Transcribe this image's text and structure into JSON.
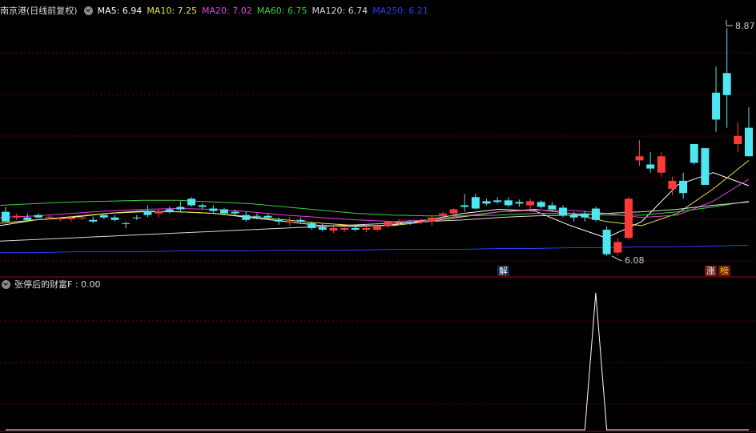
{
  "header": {
    "stock_title": "南京港(日线前复权)",
    "ma": [
      {
        "label": "MA5: 6.94",
        "color": "#ffffff"
      },
      {
        "label": "MA10: 7.25",
        "color": "#e6e64a"
      },
      {
        "label": "MA20: 7.02",
        "color": "#e040e0"
      },
      {
        "label": "MA60: 6.75",
        "color": "#3fcf3f"
      },
      {
        "label": "MA120: 6.74",
        "color": "#d8d8d8"
      },
      {
        "label": "MA250: 6.21",
        "color": "#2a3cff"
      }
    ]
  },
  "price_labels": {
    "high": "8.87",
    "low": "6.08"
  },
  "markers": {
    "jie": "解",
    "zhang": "涨",
    "bang": "榜"
  },
  "indicator": {
    "label": "张停后的财富F : 0.00"
  },
  "colors": {
    "up": "#ff3a3a",
    "down": "#4ee6f0",
    "grid": "#7a0000",
    "frame": "#b00000"
  },
  "chart_data": {
    "type": "candlestick",
    "price_range": [
      5.9,
      9.0
    ],
    "candles": [
      [
        6.62,
        6.68,
        6.55,
        6.5
      ],
      [
        6.55,
        6.6,
        6.52,
        6.57
      ],
      [
        6.55,
        6.6,
        6.5,
        6.52
      ],
      [
        6.58,
        6.6,
        6.54,
        6.55
      ],
      [
        6.55,
        6.58,
        6.52,
        6.56
      ],
      [
        6.53,
        6.55,
        6.5,
        6.54
      ],
      [
        6.53,
        6.56,
        6.5,
        6.55
      ],
      [
        6.54,
        6.58,
        6.52,
        6.55
      ],
      [
        6.52,
        6.56,
        6.48,
        6.5
      ],
      [
        6.58,
        6.6,
        6.53,
        6.55
      ],
      [
        6.55,
        6.58,
        6.5,
        6.52
      ],
      [
        6.48,
        6.5,
        6.42,
        6.47
      ],
      [
        6.55,
        6.58,
        6.52,
        6.54
      ],
      [
        6.63,
        6.7,
        6.55,
        6.58
      ],
      [
        6.6,
        6.65,
        6.55,
        6.63
      ],
      [
        6.65,
        6.68,
        6.6,
        6.62
      ],
      [
        6.68,
        6.75,
        6.62,
        6.65
      ],
      [
        6.78,
        6.8,
        6.68,
        6.7
      ],
      [
        6.7,
        6.72,
        6.65,
        6.68
      ],
      [
        6.66,
        6.7,
        6.6,
        6.63
      ],
      [
        6.65,
        6.67,
        6.58,
        6.6
      ],
      [
        6.62,
        6.65,
        6.57,
        6.6
      ],
      [
        6.58,
        6.63,
        6.5,
        6.52
      ],
      [
        6.57,
        6.6,
        6.53,
        6.56
      ],
      [
        6.57,
        6.6,
        6.52,
        6.55
      ],
      [
        6.52,
        6.55,
        6.46,
        6.5
      ],
      [
        6.5,
        6.56,
        6.45,
        6.5
      ],
      [
        6.52,
        6.55,
        6.48,
        6.5
      ],
      [
        6.48,
        6.5,
        6.4,
        6.42
      ],
      [
        6.43,
        6.47,
        6.38,
        6.4
      ],
      [
        6.39,
        6.44,
        6.36,
        6.42
      ],
      [
        6.4,
        6.45,
        6.37,
        6.42
      ],
      [
        6.42,
        6.45,
        6.38,
        6.4
      ],
      [
        6.4,
        6.44,
        6.37,
        6.42
      ],
      [
        6.4,
        6.45,
        6.38,
        6.44
      ],
      [
        6.45,
        6.5,
        6.42,
        6.5
      ],
      [
        6.5,
        6.53,
        6.45,
        6.5
      ],
      [
        6.5,
        6.52,
        6.46,
        6.49
      ],
      [
        6.5,
        6.53,
        6.47,
        6.5
      ],
      [
        6.5,
        6.58,
        6.45,
        6.55
      ],
      [
        6.58,
        6.62,
        6.55,
        6.6
      ],
      [
        6.6,
        6.66,
        6.55,
        6.65
      ],
      [
        6.7,
        6.84,
        6.62,
        6.68
      ],
      [
        6.8,
        6.84,
        6.65,
        6.66
      ],
      [
        6.75,
        6.78,
        6.7,
        6.72
      ],
      [
        6.76,
        6.8,
        6.72,
        6.74
      ],
      [
        6.76,
        6.8,
        6.68,
        6.7
      ],
      [
        6.74,
        6.77,
        6.68,
        6.72
      ],
      [
        6.7,
        6.78,
        6.65,
        6.75
      ],
      [
        6.74,
        6.76,
        6.66,
        6.68
      ],
      [
        6.7,
        6.74,
        6.62,
        6.65
      ],
      [
        6.67,
        6.7,
        6.55,
        6.58
      ],
      [
        6.58,
        6.62,
        6.5,
        6.55
      ],
      [
        6.6,
        6.63,
        6.5,
        6.55
      ],
      [
        6.66,
        6.68,
        6.5,
        6.52
      ],
      [
        6.4,
        6.44,
        6.08,
        6.1
      ],
      [
        6.12,
        6.3,
        6.08,
        6.25
      ],
      [
        6.3,
        6.8,
        6.28,
        6.78
      ],
      [
        7.25,
        7.5,
        7.18,
        7.3
      ],
      [
        7.2,
        7.35,
        7.1,
        7.15
      ],
      [
        7.1,
        7.35,
        7.05,
        7.3
      ],
      [
        6.9,
        7.05,
        6.82,
        7.0
      ],
      [
        7.0,
        7.1,
        6.78,
        6.85
      ],
      [
        7.45,
        7.45,
        7.2,
        7.22
      ],
      [
        7.4,
        7.4,
        6.95,
        6.95
      ],
      [
        8.08,
        8.4,
        7.6,
        7.75
      ],
      [
        8.32,
        8.87,
        7.65,
        8.05
      ],
      [
        7.45,
        7.72,
        7.35,
        7.55
      ],
      [
        7.65,
        7.9,
        7.3,
        7.3
      ]
    ],
    "ma": {
      "MA5": [
        6.45,
        6.52,
        6.55,
        6.6,
        6.63,
        6.62,
        6.6,
        6.55,
        6.5,
        6.45,
        6.44,
        6.46,
        6.52,
        6.6,
        6.65,
        6.63,
        6.45,
        6.3,
        6.5,
        6.95,
        7.1,
        6.94
      ],
      "MA10": [
        6.48,
        6.52,
        6.56,
        6.6,
        6.62,
        6.62,
        6.6,
        6.56,
        6.52,
        6.48,
        6.45,
        6.45,
        6.5,
        6.56,
        6.62,
        6.65,
        6.6,
        6.5,
        6.45,
        6.6,
        6.9,
        7.25
      ],
      "MA20": [
        6.55,
        6.57,
        6.6,
        6.63,
        6.65,
        6.66,
        6.65,
        6.62,
        6.58,
        6.55,
        6.52,
        6.5,
        6.52,
        6.57,
        6.62,
        6.64,
        6.64,
        6.6,
        6.55,
        6.58,
        6.75,
        7.02
      ],
      "MA60": [
        6.7,
        6.72,
        6.74,
        6.75,
        6.76,
        6.76,
        6.74,
        6.72,
        6.68,
        6.64,
        6.6,
        6.58,
        6.57,
        6.57,
        6.58,
        6.6,
        6.6,
        6.58,
        6.58,
        6.62,
        6.68,
        6.75
      ],
      "MA120": [
        6.26,
        6.28,
        6.3,
        6.32,
        6.34,
        6.36,
        6.38,
        6.4,
        6.42,
        6.44,
        6.46,
        6.48,
        6.5,
        6.52,
        6.55,
        6.57,
        6.58,
        6.6,
        6.62,
        6.65,
        6.7,
        6.74
      ],
      "MA250": [
        6.12,
        6.12,
        6.13,
        6.13,
        6.13,
        6.14,
        6.14,
        6.14,
        6.15,
        6.15,
        6.15,
        6.16,
        6.16,
        6.16,
        6.17,
        6.17,
        6.18,
        6.18,
        6.19,
        6.19,
        6.2,
        6.21
      ]
    },
    "indicator_values": [
      0,
      0,
      0,
      0,
      0,
      0,
      0,
      0,
      0,
      0,
      0,
      0,
      0,
      0,
      0,
      0,
      0,
      0,
      0,
      0,
      0,
      0,
      0,
      0,
      0,
      0,
      0,
      0,
      0,
      0,
      0,
      0,
      0,
      0,
      0,
      0,
      0,
      0,
      0,
      0,
      0,
      0,
      0,
      0,
      0,
      0,
      0,
      0,
      0,
      0,
      0,
      0,
      0,
      0,
      1,
      0,
      0,
      0,
      0,
      0,
      0,
      0,
      0,
      0,
      0,
      0,
      0,
      0,
      0
    ]
  }
}
